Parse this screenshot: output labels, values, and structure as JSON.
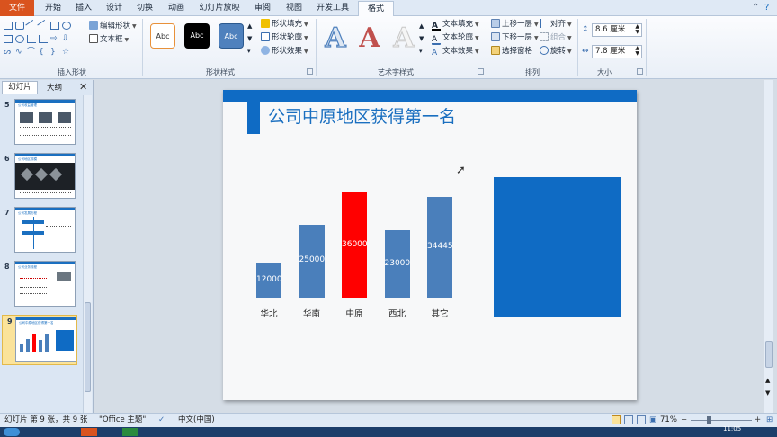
{
  "ribbon_tabs": [
    "文件",
    "开始",
    "插入",
    "设计",
    "切换",
    "动画",
    "幻灯片放映",
    "审阅",
    "视图",
    "开发工具",
    "格式"
  ],
  "ribbon": {
    "insert_shapes": {
      "edit_shape": "编辑形状",
      "text_box": "文本框",
      "label": "插入形状"
    },
    "shape_styles": {
      "sample": "Abc",
      "fill": "形状填充",
      "outline": "形状轮廓",
      "effects": "形状效果",
      "label": "形状样式"
    },
    "wordart_styles": {
      "glyph": "A",
      "text_fill": "文本填充",
      "text_outline": "文本轮廓",
      "text_effects": "文本效果",
      "label": "艺术字样式"
    },
    "arrange": {
      "bring_forward": "上移一层",
      "send_backward": "下移一层",
      "selection_pane": "选择窗格",
      "align": "对齐",
      "group": "组合",
      "rotate": "旋转",
      "label": "排列"
    },
    "size": {
      "height": "8.6 厘米",
      "width": "7.8 厘米",
      "label": "大小"
    }
  },
  "left_panel": {
    "tabs": [
      "幻灯片",
      "大纲"
    ],
    "slides": [
      {
        "num": "5",
        "title": "公司收益管理"
      },
      {
        "num": "6",
        "title": "公司地区规模"
      },
      {
        "num": "7",
        "title": "公司发展历程"
      },
      {
        "num": "8",
        "title": "公司业务流程"
      },
      {
        "num": "9",
        "title": "公司中原地区获得第一名"
      }
    ]
  },
  "slide": {
    "title": "公司中原地区获得第一名"
  },
  "chart_data": {
    "type": "bar",
    "categories": [
      "华北",
      "华南",
      "中原",
      "西北",
      "其它"
    ],
    "values": [
      12000,
      25000,
      36000,
      23000,
      34445
    ],
    "highlight_index": 2,
    "colors": {
      "default": "#4a7fbb",
      "highlight": "#ff0000"
    },
    "title": "",
    "xlabel": "",
    "ylabel": ""
  },
  "status": {
    "slide_info": "幻灯片 第 9 张，共 9 张",
    "theme": "\"Office 主题\"",
    "language": "中文(中国)",
    "zoom": "71%",
    "clock": "11:05"
  }
}
